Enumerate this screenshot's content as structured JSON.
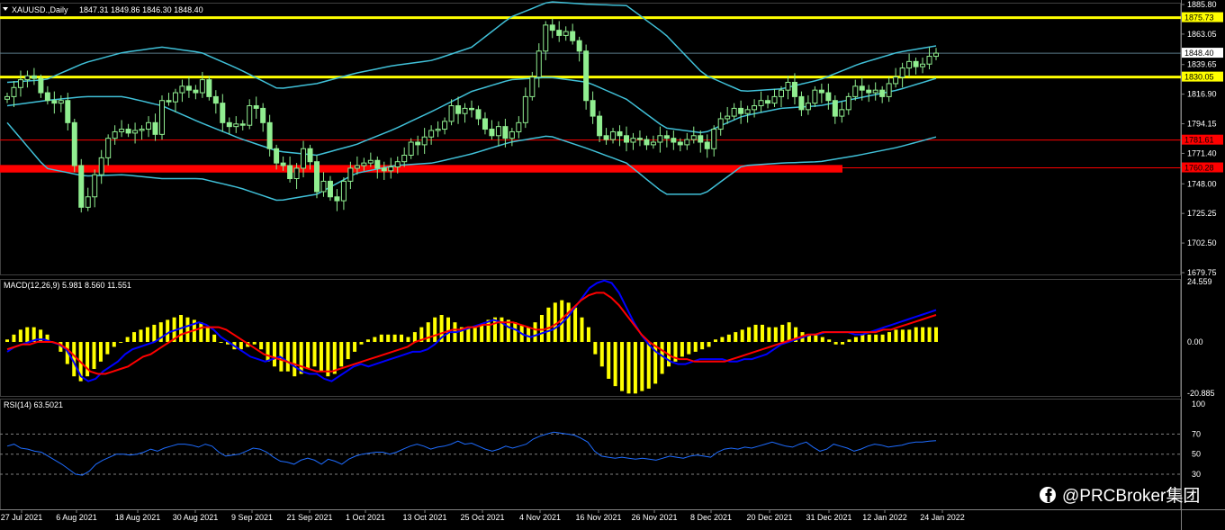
{
  "header": {
    "symbol": "XAUUSD.,Daily",
    "ohlc": "1847.31 1849.86 1846.30 1848.40"
  },
  "watermark": "@PRCBroker集团",
  "icons": {
    "watermark_logo": "facebook-icon",
    "menu": "triangle-down-icon"
  },
  "colors": {
    "background": "#000000",
    "candle": "#90ee90",
    "bollinger": "#40c0d8",
    "yellow_level": "#ffff00",
    "red_level": "#ff0000",
    "macd_histogram": "#ffff00",
    "macd_main": "#0000ff",
    "macd_signal": "#ff0000",
    "rsi_line": "#1e6cff",
    "grid": "#808080"
  },
  "chart_data": [
    {
      "type": "candlestick",
      "title": "XAUUSD.,Daily",
      "ohlc_last": {
        "open": 1847.31,
        "high": 1849.86,
        "low": 1846.3,
        "close": 1848.4
      },
      "ylim": [
        1679.75,
        1885.8
      ],
      "y_ticks": [
        1885.8,
        1863.05,
        1839.65,
        1816.9,
        1794.15,
        1771.4,
        1748.0,
        1725.25,
        1702.5,
        1679.75
      ],
      "x_tick_labels": [
        "27 Jul 2021",
        "6 Aug 2021",
        "18 Aug 2021",
        "30 Aug 2021",
        "9 Sep 2021",
        "21 Sep 2021",
        "1 Oct 2021",
        "13 Oct 2021",
        "25 Oct 2021",
        "4 Nov 2021",
        "16 Nov 2021",
        "26 Nov 2021",
        "8 Dec 2021",
        "20 Dec 2021",
        "31 Dec 2021",
        "12 Jan 2022",
        "24 Jan 2022"
      ],
      "levels": [
        {
          "value": 1875.73,
          "label": "1875.73",
          "color": "#ffff00"
        },
        {
          "value": 1848.4,
          "label": "1848.40",
          "color": "#ffffff"
        },
        {
          "value": 1830.05,
          "label": "1830.05",
          "color": "#ffff00"
        },
        {
          "value": 1781.61,
          "label": "1781.61",
          "color": "#ff0000"
        },
        {
          "value": 1760.28,
          "label": "1760.28",
          "color": "#ff0000"
        }
      ],
      "closes": [
        1815,
        1822,
        1828,
        1831,
        1829,
        1818,
        1812,
        1810,
        1812,
        1795,
        1762,
        1730,
        1738,
        1755,
        1768,
        1783,
        1788,
        1790,
        1787,
        1789,
        1790,
        1795,
        1786,
        1812,
        1811,
        1818,
        1823,
        1820,
        1818,
        1828,
        1815,
        1810,
        1795,
        1792,
        1794,
        1793,
        1808,
        1806,
        1795,
        1775,
        1764,
        1762,
        1752,
        1760,
        1775,
        1765,
        1742,
        1750,
        1738,
        1735,
        1750,
        1760,
        1762,
        1764,
        1766,
        1760,
        1758,
        1761,
        1765,
        1770,
        1780,
        1778,
        1784,
        1789,
        1790,
        1796,
        1808,
        1802,
        1806,
        1805,
        1798,
        1790,
        1785,
        1792,
        1783,
        1788,
        1795,
        1815,
        1830,
        1850,
        1870,
        1866,
        1862,
        1865,
        1858,
        1850,
        1812,
        1800,
        1785,
        1782,
        1788,
        1785,
        1780,
        1783,
        1782,
        1778,
        1780,
        1785,
        1783,
        1780,
        1778,
        1782,
        1785,
        1780,
        1775,
        1790,
        1798,
        1800,
        1806,
        1802,
        1805,
        1808,
        1812,
        1810,
        1815,
        1820,
        1826,
        1815,
        1805,
        1810,
        1820,
        1818,
        1812,
        1800,
        1805,
        1815,
        1823,
        1820,
        1818,
        1820,
        1815,
        1825,
        1830,
        1837,
        1842,
        1838,
        1840,
        1846,
        1848.4
      ],
      "bollinger": {
        "period": 20,
        "upper_dots": [
          1826,
          1828,
          1841,
          1849,
          1853,
          1849,
          1836,
          1821,
          1825,
          1833,
          1839,
          1843,
          1853,
          1876,
          1888,
          1886,
          1885,
          1863,
          1832,
          1819,
          1821,
          1828,
          1840,
          1849,
          1854
        ],
        "mid_dots": [
          1808,
          1812,
          1815,
          1815,
          1808,
          1795,
          1783,
          1773,
          1770,
          1778,
          1790,
          1804,
          1819,
          1828,
          1830,
          1826,
          1813,
          1791,
          1787,
          1800,
          1806,
          1808,
          1814,
          1820,
          1829
        ],
        "lower_dots": [
          1795,
          1760,
          1754,
          1755,
          1752,
          1752,
          1745,
          1735,
          1740,
          1756,
          1762,
          1764,
          1771,
          1780,
          1785,
          1775,
          1764,
          1740,
          1740,
          1762,
          1764,
          1765,
          1770,
          1776,
          1784
        ]
      }
    },
    {
      "type": "line",
      "title": "MACD(12,26,9) 5.981 8.560 11.551",
      "ylim": [
        -20.885,
        24.559
      ],
      "y_ticks": [
        24.559,
        0.0,
        -20.885
      ],
      "series": [
        {
          "name": "histogram",
          "values": [
            1,
            3,
            5,
            6,
            6,
            5,
            3,
            0,
            -4,
            -9,
            -14,
            -16,
            -14,
            -11,
            -8,
            -5,
            -2,
            0,
            2,
            4,
            5,
            6,
            7,
            8,
            9,
            10,
            11,
            10,
            9,
            8,
            6,
            3,
            0,
            -1,
            -3,
            -3,
            -2,
            -1,
            -3,
            -8,
            -10,
            -12,
            -12,
            -14,
            -13,
            -11,
            -10,
            -12,
            -14,
            -13,
            -10,
            -7,
            -4,
            -1,
            1,
            2,
            3,
            3,
            3,
            3,
            2,
            4,
            6,
            8,
            10,
            11,
            10,
            8,
            6,
            6,
            6,
            7,
            9,
            10,
            10,
            9,
            8,
            7,
            6,
            8,
            11,
            14,
            16,
            17,
            16,
            14,
            10,
            6,
            -5,
            -10,
            -15,
            -18,
            -20,
            -21,
            -21,
            -20,
            -19,
            -17,
            -13,
            -10,
            -8,
            -6,
            -5,
            -4,
            -3,
            -2,
            1,
            2,
            3,
            4,
            5,
            6,
            7,
            7,
            6,
            6,
            7,
            8,
            6,
            4,
            3,
            3,
            2,
            1,
            -1,
            -1,
            1,
            2,
            3,
            3,
            3,
            3,
            4,
            5,
            5,
            5,
            6,
            6,
            6,
            6
          ]
        },
        {
          "name": "main",
          "values": [
            -4,
            -2,
            -1,
            0,
            1,
            1,
            0,
            -1,
            -3,
            -8,
            -14,
            -16,
            -15,
            -12,
            -10,
            -8,
            -5,
            -3,
            -2,
            -1,
            0,
            2,
            4,
            5,
            6,
            7,
            8,
            7,
            5,
            2,
            0,
            -2,
            -4,
            -6,
            -7,
            -8,
            -7,
            -6,
            -8,
            -10,
            -12,
            -13,
            -13,
            -15,
            -16,
            -14,
            -12,
            -10,
            -9,
            -10,
            -9,
            -8,
            -7,
            -6,
            -5,
            -4,
            -4,
            -3,
            -1,
            2,
            4,
            4,
            5,
            6,
            7,
            8,
            9,
            8,
            6,
            5,
            3,
            2,
            3,
            4,
            5,
            7,
            10,
            14,
            18,
            22,
            24,
            25,
            24,
            20,
            14,
            8,
            3,
            -1,
            -4,
            -6,
            -8,
            -9,
            -9,
            -8,
            -7,
            -7,
            -7,
            -7,
            -8,
            -8,
            -7,
            -7,
            -6,
            -5,
            -3,
            -1,
            0,
            1,
            2,
            3,
            3,
            4,
            4,
            4,
            4,
            3,
            3,
            4,
            5,
            6,
            7,
            8,
            9,
            10,
            11,
            12,
            13
          ]
        },
        {
          "name": "signal",
          "values": [
            -3,
            -2,
            -1,
            -1,
            0,
            0,
            0,
            -1,
            -3,
            -6,
            -9,
            -12,
            -13,
            -13,
            -12,
            -11,
            -10,
            -8,
            -6,
            -5,
            -3,
            -1,
            1,
            3,
            4,
            5,
            6,
            6,
            6,
            5,
            3,
            1,
            -1,
            -3,
            -5,
            -6,
            -7,
            -8,
            -9,
            -10,
            -11,
            -12,
            -12,
            -12,
            -11,
            -10,
            -9,
            -8,
            -7,
            -6,
            -5,
            -4,
            -3,
            -2,
            0,
            1,
            2,
            3,
            4,
            5,
            5,
            6,
            6,
            7,
            7,
            8,
            8,
            8,
            7,
            6,
            5,
            5,
            6,
            8,
            11,
            14,
            17,
            19,
            20,
            20,
            18,
            15,
            11,
            7,
            3,
            0,
            -2,
            -4,
            -6,
            -7,
            -7,
            -8,
            -8,
            -8,
            -8,
            -8,
            -7,
            -6,
            -5,
            -4,
            -3,
            -2,
            -1,
            0,
            1,
            2,
            3,
            3,
            4,
            4,
            4,
            4,
            4,
            4,
            4,
            4,
            5,
            5,
            6,
            7,
            8,
            9,
            10,
            11
          ]
        }
      ]
    },
    {
      "type": "line",
      "title": "RSI(14) 63.5021",
      "ylim": [
        0,
        100
      ],
      "y_ticks": [
        100,
        70,
        50,
        30
      ],
      "levels": [
        70,
        50,
        30
      ],
      "series": [
        {
          "name": "RSI",
          "values": [
            58,
            60,
            56,
            55,
            53,
            52,
            48,
            44,
            40,
            35,
            30,
            29,
            33,
            40,
            44,
            47,
            50,
            50,
            49,
            50,
            52,
            55,
            53,
            56,
            58,
            60,
            60,
            59,
            57,
            60,
            58,
            52,
            48,
            49,
            50,
            53,
            56,
            55,
            52,
            47,
            43,
            42,
            40,
            44,
            46,
            44,
            40,
            45,
            43,
            40,
            45,
            48,
            50,
            51,
            52,
            52,
            50,
            52,
            55,
            58,
            60,
            58,
            55,
            57,
            58,
            60,
            63,
            60,
            61,
            58,
            55,
            53,
            55,
            58,
            56,
            58,
            60,
            65,
            68,
            70,
            72,
            71,
            70,
            69,
            66,
            62,
            53,
            48,
            47,
            46,
            47,
            46,
            45,
            46,
            45,
            44,
            46,
            48,
            47,
            46,
            48,
            49,
            48,
            47,
            52,
            55,
            56,
            55,
            57,
            56,
            58,
            60,
            62,
            60,
            58,
            57,
            60,
            62,
            57,
            53,
            55,
            60,
            58,
            56,
            53,
            55,
            58,
            60,
            59,
            57,
            58,
            59,
            61,
            62,
            62,
            63,
            63.5
          ]
        }
      ]
    }
  ]
}
